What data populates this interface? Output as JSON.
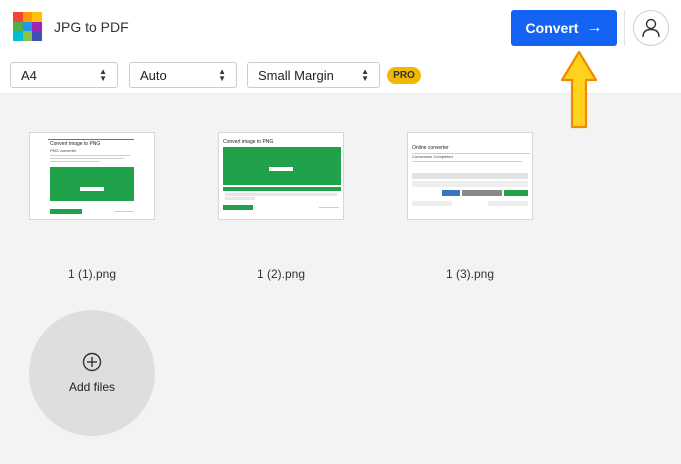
{
  "header": {
    "title": "JPG to PDF",
    "convert_label": "Convert",
    "convert_arrow": "→",
    "logo_colors": [
      "#f44336",
      "#ff9800",
      "#ffc107",
      "#4caf50",
      "#2196f3",
      "#9c27b0",
      "#00bcd4",
      "#8bc34a",
      "#3f51b5"
    ]
  },
  "toolbar": {
    "page_size": "A4",
    "orientation": "Auto",
    "margin": "Small Margin",
    "pro_label": "PRO"
  },
  "files": [
    {
      "name": "1 (1).png",
      "thumb_title": "Convert image to PNG",
      "thumb_subtitle": "PNG converter"
    },
    {
      "name": "1 (2).png",
      "thumb_title": "Convert image to PNG",
      "thumb_subtitle": ""
    },
    {
      "name": "1 (3).png",
      "thumb_title": "Online converter",
      "thumb_subtitle": "Conversion Completed"
    }
  ],
  "add_files": {
    "label": "Add files",
    "icon": "plus-circle-icon"
  },
  "colors": {
    "accent": "#1463f3",
    "pro_badge": "#f2b705",
    "thumb_green": "#1fa24a",
    "annotation_arrow": "#ffd21e"
  }
}
